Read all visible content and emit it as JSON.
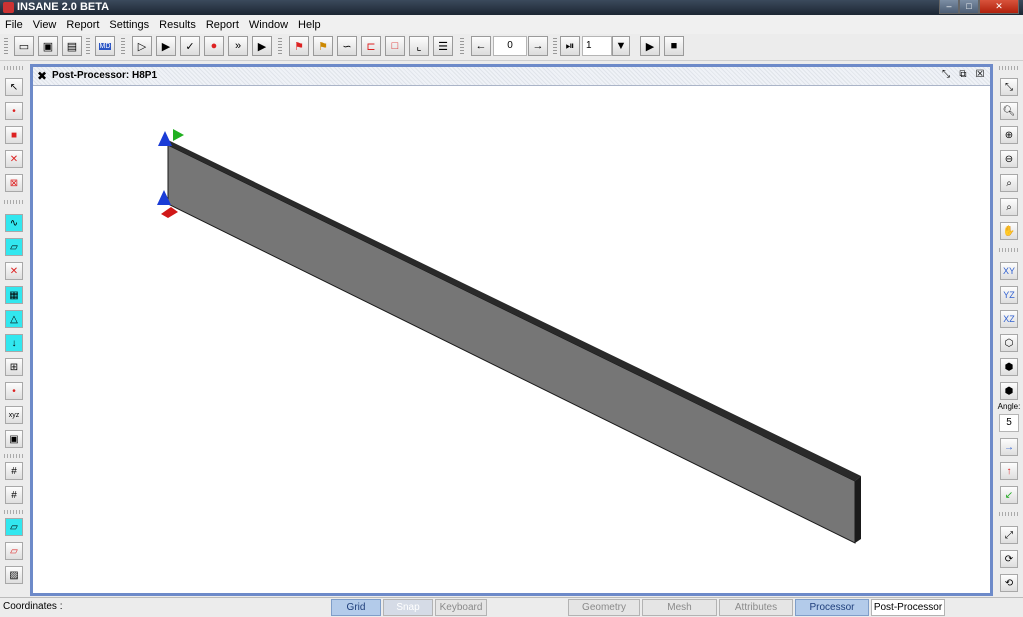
{
  "window": {
    "title": "INSANE 2.0 BETA"
  },
  "menu": [
    "File",
    "View",
    "Report",
    "Settings",
    "Results",
    "Report",
    "Window",
    "Help"
  ],
  "toolbar": {
    "step_value": "0",
    "combo_value": "1"
  },
  "left_sidebar": {
    "tools": [
      "select-pointer",
      "point",
      "rectangle",
      "delete",
      "delete-region",
      "node",
      "element",
      "restraint",
      "grid",
      "triangle",
      "load",
      "support",
      "release",
      "coordinates",
      "attribute",
      "grid-a",
      "grid-b",
      "note",
      "note-b",
      "note-c"
    ]
  },
  "right_sidebar": {
    "view_buttons": [
      "XY",
      "YZ",
      "XZ"
    ],
    "angle_label": "Angle:",
    "angle_value": "5"
  },
  "internal_frame": {
    "title": "Post-Processor: H8P1"
  },
  "statusbar": {
    "coordinates_label": "Coordinates :",
    "buttons": [
      {
        "label": "Grid",
        "state": "on"
      },
      {
        "label": "Snap",
        "state": "disabled"
      },
      {
        "label": "Keyboard",
        "state": "off"
      },
      {
        "label": "Geometry",
        "state": "off"
      },
      {
        "label": "Mesh",
        "state": "off"
      },
      {
        "label": "Attributes",
        "state": "off"
      },
      {
        "label": "Processor",
        "state": "on"
      },
      {
        "label": "Post-Processor",
        "state": "selected"
      }
    ]
  },
  "colors": {
    "beam_face": "#767676",
    "beam_top": "#2a2a2a",
    "frame_border": "#6d8ac9",
    "active_tool": "#32e7ef",
    "axis_blue": "#1a3cd6",
    "axis_green": "#20b020",
    "axis_red": "#d01818"
  }
}
